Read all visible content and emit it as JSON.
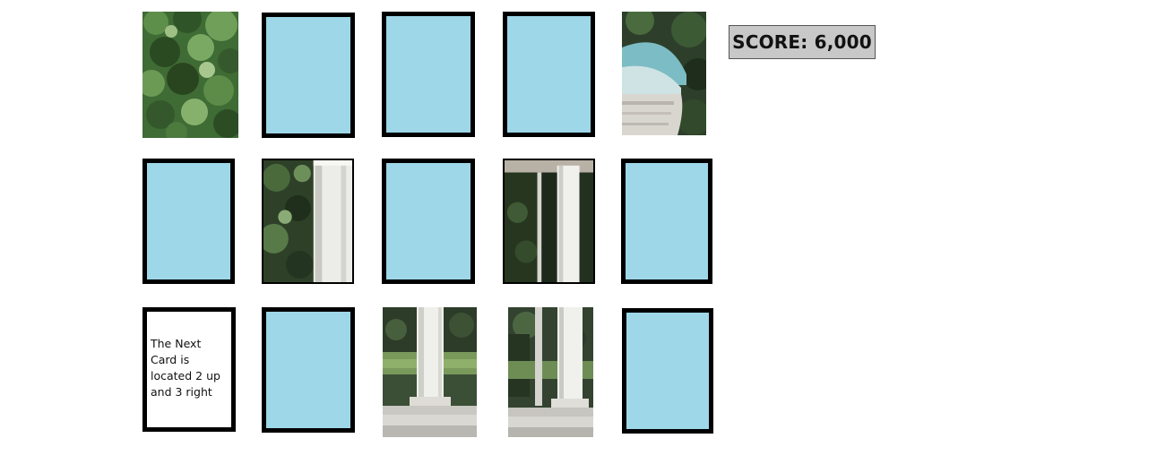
{
  "game": {
    "score_label": "SCORE: 6,000",
    "hint_text": "The Next\nCard  is\nlocated 2 up\nand 3 right",
    "card_back_color": "#9dd7e8",
    "cards": [
      {
        "row": 1,
        "col": 1,
        "state": "revealed",
        "content": "tree-foliage-image"
      },
      {
        "row": 1,
        "col": 2,
        "state": "face-down"
      },
      {
        "row": 1,
        "col": 3,
        "state": "face-down"
      },
      {
        "row": 1,
        "col": 4,
        "state": "face-down"
      },
      {
        "row": 1,
        "col": 5,
        "state": "revealed",
        "content": "gazebo-dome-image"
      },
      {
        "row": 2,
        "col": 1,
        "state": "face-down"
      },
      {
        "row": 2,
        "col": 2,
        "state": "revealed",
        "content": "trees-column-image"
      },
      {
        "row": 2,
        "col": 3,
        "state": "face-down"
      },
      {
        "row": 2,
        "col": 4,
        "state": "revealed",
        "content": "column-doorway-image"
      },
      {
        "row": 2,
        "col": 5,
        "state": "face-down"
      },
      {
        "row": 3,
        "col": 1,
        "state": "revealed",
        "content": "hint-text"
      },
      {
        "row": 3,
        "col": 2,
        "state": "face-down"
      },
      {
        "row": 3,
        "col": 3,
        "state": "revealed",
        "content": "column-base-lawn-image"
      },
      {
        "row": 3,
        "col": 4,
        "state": "revealed",
        "content": "column-base-steps-image"
      },
      {
        "row": 3,
        "col": 5,
        "state": "face-down"
      }
    ]
  }
}
